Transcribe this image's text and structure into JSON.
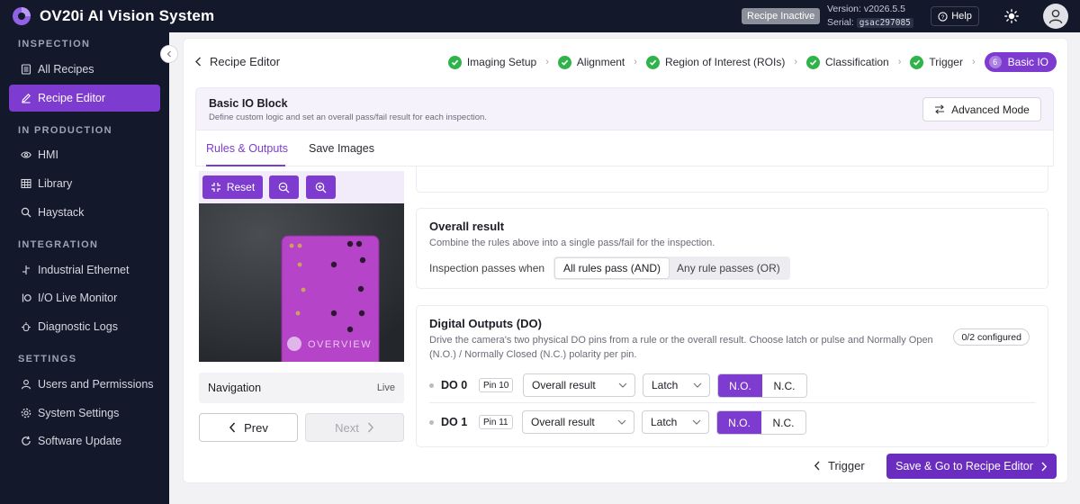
{
  "app": {
    "title": "OV20i AI Vision System",
    "recipe_status": "Recipe Inactive",
    "version_label": "Version: v2026.5.5",
    "serial_label": "Serial:",
    "serial_value": "gsac297085",
    "help_label": "Help"
  },
  "sidebar": {
    "sections": [
      {
        "title": "INSPECTION",
        "items": [
          {
            "label": "All Recipes",
            "icon": "list-icon"
          },
          {
            "label": "Recipe Editor",
            "icon": "pencil-icon",
            "active": true
          }
        ]
      },
      {
        "title": "IN PRODUCTION",
        "items": [
          {
            "label": "HMI",
            "icon": "eye-icon"
          },
          {
            "label": "Library",
            "icon": "grid-icon"
          },
          {
            "label": "Haystack",
            "icon": "search-icon"
          }
        ]
      },
      {
        "title": "INTEGRATION",
        "items": [
          {
            "label": "Industrial Ethernet",
            "icon": "network-icon"
          },
          {
            "label": "I/O Live Monitor",
            "icon": "io-icon"
          },
          {
            "label": "Diagnostic Logs",
            "icon": "bug-icon"
          }
        ]
      },
      {
        "title": "SETTINGS",
        "items": [
          {
            "label": "Users and Permissions",
            "icon": "user-icon"
          },
          {
            "label": "System Settings",
            "icon": "gear-icon"
          },
          {
            "label": "Software Update",
            "icon": "refresh-icon"
          }
        ]
      }
    ]
  },
  "editor": {
    "breadcrumb": "Recipe Editor",
    "steps": [
      "Imaging Setup",
      "Alignment",
      "Region of Interest (ROIs)",
      "Classification",
      "Trigger"
    ],
    "current_step": {
      "number": "6",
      "label": "Basic IO"
    },
    "block_title": "Basic IO Block",
    "block_subtitle": "Define custom logic and set an overall pass/fail result for each inspection.",
    "advanced_mode": "Advanced Mode",
    "tabs": [
      "Rules & Outputs",
      "Save Images"
    ]
  },
  "preview": {
    "reset": "Reset",
    "overlay_text": "OVERVIEW",
    "navigation_label": "Navigation",
    "navigation_mode": "Live",
    "prev": "Prev",
    "next": "Next"
  },
  "overall": {
    "title": "Overall result",
    "subtitle": "Combine the rules above into a single pass/fail for the inspection.",
    "passes_label": "Inspection passes when",
    "options": [
      "All rules pass (AND)",
      "Any rule passes (OR)"
    ],
    "selected": "All rules pass (AND)"
  },
  "digital_outputs": {
    "title": "Digital Outputs (DO)",
    "subtitle_line1": "Drive the camera's two physical DO pins from a rule or the overall result. Choose latch or pulse and Normally Open",
    "subtitle_line2": "(N.O.) / Normally Closed (N.C.) polarity per pin.",
    "configured": "0/2 configured",
    "rows": [
      {
        "name": "DO 0",
        "pin": "Pin 10",
        "source": "Overall result",
        "mode": "Latch",
        "polarity_options": [
          "N.O.",
          "N.C."
        ],
        "polarity": "N.O."
      },
      {
        "name": "DO 1",
        "pin": "Pin 11",
        "source": "Overall result",
        "mode": "Latch",
        "polarity_options": [
          "N.O.",
          "N.C."
        ],
        "polarity": "N.O."
      }
    ]
  },
  "footer": {
    "back": "Trigger",
    "save": "Save & Go to Recipe Editor"
  },
  "colors": {
    "accent": "#7d3ccf",
    "sidebar_bg": "#13182b",
    "success": "#2fb34a"
  }
}
